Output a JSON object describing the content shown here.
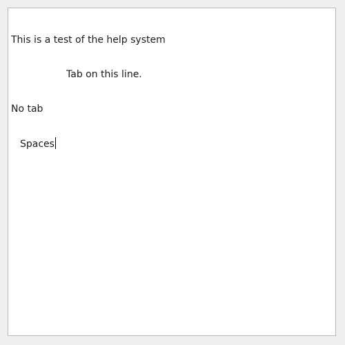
{
  "editor": {
    "lines": [
      "This is a test of the help system",
      "Tab on this line.",
      "No tab",
      "Spaces"
    ]
  }
}
